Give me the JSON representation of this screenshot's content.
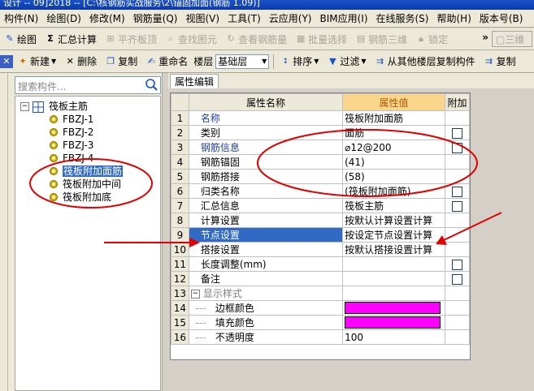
{
  "titlebar": {
    "text": "设计 -- 09]2018 -- [C:\\核钢筋实战服务\\2\\锚固加面(钢筋 1.09)]"
  },
  "menu": [
    "构件(N)",
    "绘图(D)",
    "修改(M)",
    "钢筋量(Q)",
    "视图(V)",
    "工具(T)",
    "云应用(Y)",
    "BIM应用(I)",
    "在线服务(S)",
    "帮助(H)",
    "版本号(B)"
  ],
  "toolbar1": {
    "draw": "绘图",
    "sum": "汇总计算",
    "flat_top": "平齐板顶",
    "find_elem": "查找图元",
    "view_rebar": "查看钢筋量",
    "batch_select": "批量选择",
    "rebar_3d": "钢筋三维",
    "lock": "锁定",
    "more": "»",
    "view_3d": "三维"
  },
  "toolbar2": {
    "new": "新建",
    "delete": "删除",
    "copy": "复制",
    "rename": "重命名",
    "floor_label": "楼层",
    "floor_value": "基础层",
    "sort": "排序",
    "filter": "过滤",
    "copy_from_floor": "从其他楼层复制构件",
    "copy_to": "复制"
  },
  "search": {
    "placeholder": "搜索构件..."
  },
  "tree": {
    "root": "筏板主筋",
    "items": [
      "FBZJ-1",
      "FBZJ-2",
      "FBZJ-3",
      "FBZJ-4",
      "筏板附加面筋",
      "筏板附加中间",
      "筏板附加底"
    ],
    "selected_index": 4
  },
  "tab": {
    "label": "属性编辑"
  },
  "grid": {
    "headers": {
      "name": "属性名称",
      "value": "属性值",
      "extra": "附加"
    },
    "rows": [
      {
        "num": "1",
        "name": "名称",
        "value": "筏板附加面筋",
        "check": false
      },
      {
        "num": "2",
        "name": "类别",
        "value": "面筋",
        "check": true
      },
      {
        "num": "3",
        "name": "钢筋信息",
        "value": "⌀12@200",
        "check": true
      },
      {
        "num": "4",
        "name": "钢筋锚固",
        "value": "(41)",
        "check": false
      },
      {
        "num": "5",
        "name": "钢筋搭接",
        "value": "(58)",
        "check": false
      },
      {
        "num": "6",
        "name": "归类名称",
        "value": "(筏板附加面筋)",
        "check": true
      },
      {
        "num": "7",
        "name": "汇总信息",
        "value": "筏板主筋",
        "check": true
      },
      {
        "num": "8",
        "name": "计算设置",
        "value": "按默认计算设置计算",
        "check": false
      },
      {
        "num": "9",
        "name": "节点设置",
        "value": "按设定节点设置计算",
        "check": false
      },
      {
        "num": "10",
        "name": "搭接设置",
        "value": "按默认搭接设置计算",
        "check": false
      },
      {
        "num": "11",
        "name": "长度调整(mm)",
        "value": "",
        "check": true
      },
      {
        "num": "12",
        "name": "备注",
        "value": "",
        "check": true
      },
      {
        "num": "13",
        "name": "显示样式",
        "value": "",
        "check": false
      },
      {
        "num": "14",
        "name": "边框颜色",
        "value": "",
        "check": false
      },
      {
        "num": "15",
        "name": "填充颜色",
        "value": "",
        "check": false
      },
      {
        "num": "16",
        "name": "不透明度",
        "value": "100",
        "check": false
      }
    ]
  },
  "colors": {
    "accent": "#316ac5",
    "value_header": "#f9d68c",
    "swatch": "#ff00ff",
    "annotation": "#e00000"
  }
}
